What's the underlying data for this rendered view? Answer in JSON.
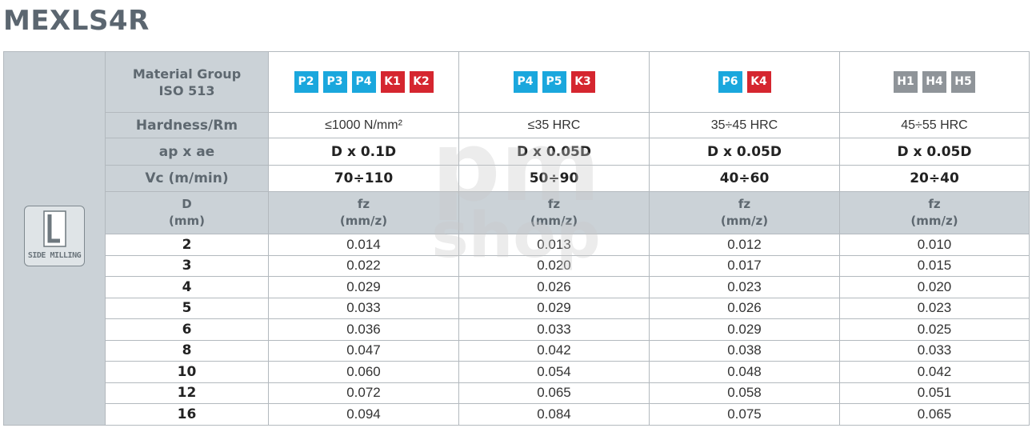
{
  "title": "MEXLS4R",
  "watermark": {
    "line1": "pm",
    "line2": "shop"
  },
  "side": {
    "icon_letter": "L",
    "label": "SIDE MILLING"
  },
  "labels": {
    "material_group_line1": "Material Group",
    "material_group_line2": "ISO 513",
    "hardness": "Hardness/Rm",
    "ap_ae": "ap x ae",
    "vc": "Vc (m/min)",
    "d_line1": "D",
    "d_line2": "(mm)"
  },
  "colors": {
    "P": "#1aa7dd",
    "K": "#d5262f",
    "H": "#8f9499"
  },
  "columns": [
    {
      "groups": [
        {
          "code": "P2",
          "type": "P"
        },
        {
          "code": "P3",
          "type": "P"
        },
        {
          "code": "P4",
          "type": "P"
        },
        {
          "code": "K1",
          "type": "K"
        },
        {
          "code": "K2",
          "type": "K"
        }
      ],
      "hardness": "≤1000 N/mm²",
      "ap_ae": "D x 0.1D",
      "vc": "70÷110",
      "fz_line1": "fz",
      "fz_line2": "(mm/z)"
    },
    {
      "groups": [
        {
          "code": "P4",
          "type": "P"
        },
        {
          "code": "P5",
          "type": "P"
        },
        {
          "code": "K3",
          "type": "K"
        }
      ],
      "hardness": "≤35 HRC",
      "ap_ae": "D x 0.05D",
      "vc": "50÷90",
      "fz_line1": "fz",
      "fz_line2": "(mm/z)"
    },
    {
      "groups": [
        {
          "code": "P6",
          "type": "P"
        },
        {
          "code": "K4",
          "type": "K"
        }
      ],
      "hardness": "35÷45 HRC",
      "ap_ae": "D x 0.05D",
      "vc": "40÷60",
      "fz_line1": "fz",
      "fz_line2": "(mm/z)"
    },
    {
      "groups": [
        {
          "code": "H1",
          "type": "H"
        },
        {
          "code": "H4",
          "type": "H"
        },
        {
          "code": "H5",
          "type": "H"
        }
      ],
      "hardness": "45÷55 HRC",
      "ap_ae": "D x 0.05D",
      "vc": "20÷40",
      "fz_line1": "fz",
      "fz_line2": "(mm/z)"
    }
  ],
  "rows": [
    {
      "d": "2",
      "fz": [
        "0.014",
        "0.013",
        "0.012",
        "0.010"
      ]
    },
    {
      "d": "3",
      "fz": [
        "0.022",
        "0.020",
        "0.017",
        "0.015"
      ]
    },
    {
      "d": "4",
      "fz": [
        "0.029",
        "0.026",
        "0.023",
        "0.020"
      ]
    },
    {
      "d": "5",
      "fz": [
        "0.033",
        "0.029",
        "0.026",
        "0.023"
      ]
    },
    {
      "d": "6",
      "fz": [
        "0.036",
        "0.033",
        "0.029",
        "0.025"
      ]
    },
    {
      "d": "8",
      "fz": [
        "0.047",
        "0.042",
        "0.038",
        "0.033"
      ]
    },
    {
      "d": "10",
      "fz": [
        "0.060",
        "0.054",
        "0.048",
        "0.042"
      ]
    },
    {
      "d": "12",
      "fz": [
        "0.072",
        "0.065",
        "0.058",
        "0.051"
      ]
    },
    {
      "d": "16",
      "fz": [
        "0.094",
        "0.084",
        "0.075",
        "0.065"
      ]
    }
  ]
}
